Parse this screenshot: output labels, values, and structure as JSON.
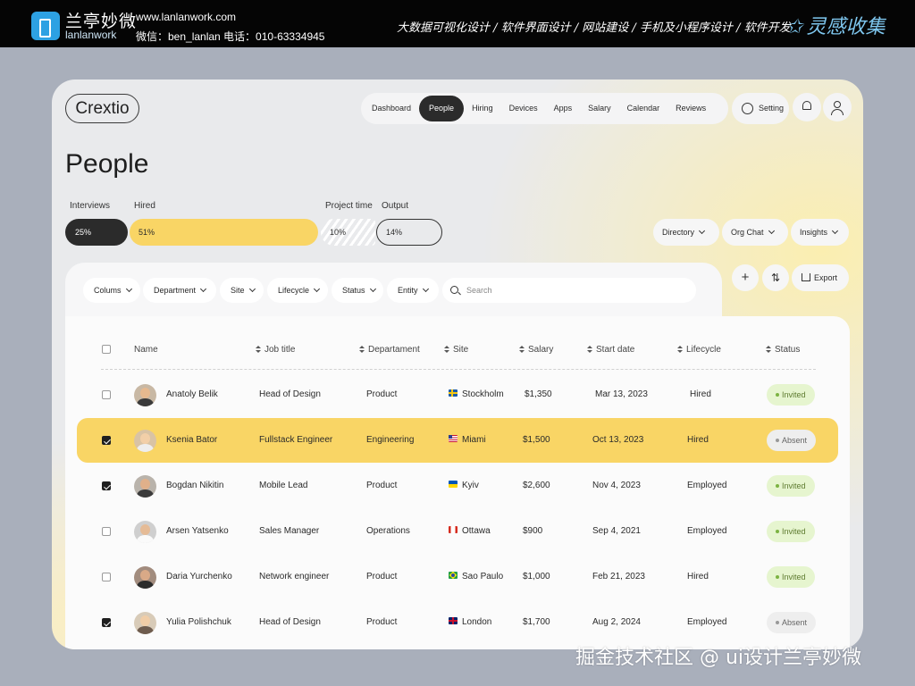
{
  "banner": {
    "logo_cn": "兰亭妙微",
    "logo_en": "lanlanwork",
    "url": "www.lanlanwork.com",
    "contact": "微信：ben_lanlan    电话：010-63334945",
    "services": "大数据可视化设计 / 软件界面设计 / 网站建设 / 手机及小程序设计 / 软件开发",
    "badge": "灵感收集"
  },
  "watermark": "掘金技术社区 @ ui设计兰亭妙微",
  "app": {
    "brand": "Crextio",
    "nav": [
      "Dashboard",
      "People",
      "Hiring",
      "Devices",
      "Apps",
      "Salary",
      "Calendar",
      "Reviews"
    ],
    "active_nav": "People",
    "setting_label": "Setting"
  },
  "page": {
    "title": "People",
    "stats": {
      "interviews_label": "Interviews",
      "interviews_value": "25%",
      "hired_label": "Hired",
      "hired_value": "51%",
      "project_time_label": "Project time",
      "project_time_value": "10%",
      "output_label": "Output",
      "output_value": "14%"
    },
    "dropdowns": [
      "Directory",
      "Org Chat",
      "Insights"
    ]
  },
  "toolbar": {
    "filters": [
      "Colums",
      "Department",
      "Site",
      "Lifecycle",
      "Status",
      "Entity"
    ],
    "search_placeholder": "Search",
    "export_label": "Export",
    "add_symbol": "+",
    "adjust_symbol": "⇅"
  },
  "table": {
    "columns": [
      "Name",
      "Job title",
      "Departament",
      "Site",
      "Salary",
      "Start date",
      "Lifecycle",
      "Status"
    ],
    "rows": [
      {
        "name": "Anatoly Belik",
        "job": "Head of Design",
        "dept": "Product",
        "site": "Stockholm",
        "salary": "$1,350",
        "start": "Mar 13, 2023",
        "lifecycle": "Hired",
        "status": "Invited",
        "checked": false
      },
      {
        "name": "Ksenia Bator",
        "job": "Fullstack Engineer",
        "dept": "Engineering",
        "site": "Miami",
        "salary": "$1,500",
        "start": "Oct 13, 2023",
        "lifecycle": "Hired",
        "status": "Absent",
        "checked": true
      },
      {
        "name": "Bogdan Nikitin",
        "job": "Mobile Lead",
        "dept": "Product",
        "site": "Kyiv",
        "salary": "$2,600",
        "start": "Nov 4, 2023",
        "lifecycle": "Employed",
        "status": "Invited",
        "checked": true
      },
      {
        "name": "Arsen Yatsenko",
        "job": "Sales Manager",
        "dept": "Operations",
        "site": "Ottawa",
        "salary": "$900",
        "start": "Sep 4, 2021",
        "lifecycle": "Employed",
        "status": "Invited",
        "checked": false
      },
      {
        "name": "Daria Yurchenko",
        "job": "Network engineer",
        "dept": "Product",
        "site": "Sao Paulo",
        "salary": "$1,000",
        "start": "Feb 21, 2023",
        "lifecycle": "Hired",
        "status": "Invited",
        "checked": false
      },
      {
        "name": "Yulia Polishchuk",
        "job": "Head of Design",
        "dept": "Product",
        "site": "London",
        "salary": "$1,700",
        "start": "Aug 2, 2024",
        "lifecycle": "Employed",
        "status": "Absent",
        "checked": true
      }
    ]
  },
  "colors": {
    "accent_yellow": "#f9d565",
    "dark": "#2b2b2b",
    "invited_bg": "#e6f5cf",
    "absent_bg": "#eeeeee"
  },
  "icons": [
    "logo-icon",
    "settings-icon",
    "bell-icon",
    "user-icon",
    "search-icon",
    "plus-icon",
    "adjust-icon",
    "export-icon",
    "chevron-down-icon",
    "sort-icon",
    "flag-icon"
  ]
}
